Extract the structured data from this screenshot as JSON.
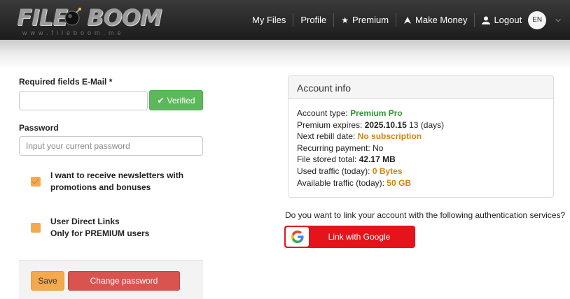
{
  "brand": {
    "logo_word_1": "FILE",
    "logo_word_2": "BOOM",
    "logo_url": "www.fileboom.me"
  },
  "nav": {
    "items": [
      {
        "label": "My Files",
        "icon": ""
      },
      {
        "label": "Profile",
        "icon": ""
      },
      {
        "label": "Premium",
        "icon": "star-icon"
      },
      {
        "label": "Make Money",
        "icon": "money-icon"
      },
      {
        "label": "Logout",
        "icon": "user-icon"
      }
    ],
    "language": "EN"
  },
  "form": {
    "email_label": "Required fields E-Mail *",
    "email_value": "",
    "verified_label": "Verified",
    "password_label": "Password",
    "password_placeholder": "Input your current password",
    "newsletter_line1": "I want to receive newsletters with",
    "newsletter_line2": "promotions and bonuses",
    "newsletter_checked": true,
    "direct_links_line1": "User Direct Links",
    "direct_links_line2": "Only for PREMIUM users",
    "direct_links_checked": false,
    "save_label": "Save",
    "change_password_label": "Change password"
  },
  "account": {
    "title": "Account info",
    "type_label": "Account type:",
    "type_value": "Premium Pro",
    "expires_label": "Premium expires:",
    "expires_date": "2025.10.15",
    "expires_days": "13 (days)",
    "rebill_label": "Next rebill date:",
    "rebill_value": "No subscription",
    "recurring_label": "Recurring payment:",
    "recurring_value": "No",
    "stored_label": "File stored total:",
    "stored_value": "42.17 MB",
    "used_label": "Used traffic (today):",
    "used_value": "0 Bytes",
    "available_label": "Available traffic (today):",
    "available_value": "50 GB"
  },
  "auth": {
    "question": "Do you want to link your account with the following authentication services?",
    "google_label": "Link with Google"
  },
  "colors": {
    "header": "#2b2b2b",
    "verified": "#5cb85c",
    "accent_orange": "#f5a94e",
    "danger": "#d9534f",
    "google_red": "#e4141a",
    "premium_green": "#2e9a2e",
    "value_orange": "#d08412"
  }
}
